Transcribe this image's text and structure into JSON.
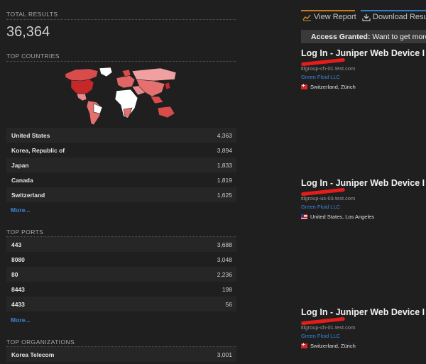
{
  "summary": {
    "total_results_label": "TOTAL RESULTS",
    "total_results_value": "36,364"
  },
  "top_countries": {
    "label": "TOP COUNTRIES",
    "items": [
      {
        "name": "United States",
        "count": "4,363"
      },
      {
        "name": "Korea, Republic of",
        "count": "3,894"
      },
      {
        "name": "Japan",
        "count": "1,833"
      },
      {
        "name": "Canada",
        "count": "1,819"
      },
      {
        "name": "Switzerland",
        "count": "1,625"
      }
    ],
    "more_label": "More..."
  },
  "top_ports": {
    "label": "TOP PORTS",
    "items": [
      {
        "name": "443",
        "count": "3,688"
      },
      {
        "name": "8080",
        "count": "3,048"
      },
      {
        "name": "80",
        "count": "2,236"
      },
      {
        "name": "8443",
        "count": "198"
      },
      {
        "name": "4433",
        "count": "56"
      }
    ],
    "more_label": "More..."
  },
  "top_organizations": {
    "label": "TOP ORGANIZATIONS",
    "items": [
      {
        "name": "Korea Telecom",
        "count": "3,001"
      }
    ]
  },
  "toolbar": {
    "view_report_label": "View Report",
    "download_label": "Download Resu"
  },
  "banner": {
    "strong": "Access Granted:",
    "text": " Want to get more"
  },
  "results": [
    {
      "title": "Log In - Juniper Web Device I",
      "host": "itlgroup-ch-01.test.com",
      "org": "Green Floid LLC",
      "location": "Switzerland, Zürich",
      "flag": "ch"
    },
    {
      "title": "Log In - Juniper Web Device I",
      "host": "itlgroup-us-03.test.com",
      "org": "Green Floid LLC",
      "location": "United States, Los Angeles",
      "flag": "us"
    },
    {
      "title": "Log In - Juniper Web Device I",
      "host": "itlgroup-ch-01.test.com",
      "org": "Green Floid LLC",
      "location": "Switzerland, Zürich",
      "flag": "ch"
    }
  ],
  "colors": {
    "background": "#1f1f1f",
    "link": "#3a86d8",
    "redaction": "#e51c1c",
    "view_report_accent": "#c97a1a",
    "download_accent": "#2f7fc9"
  }
}
